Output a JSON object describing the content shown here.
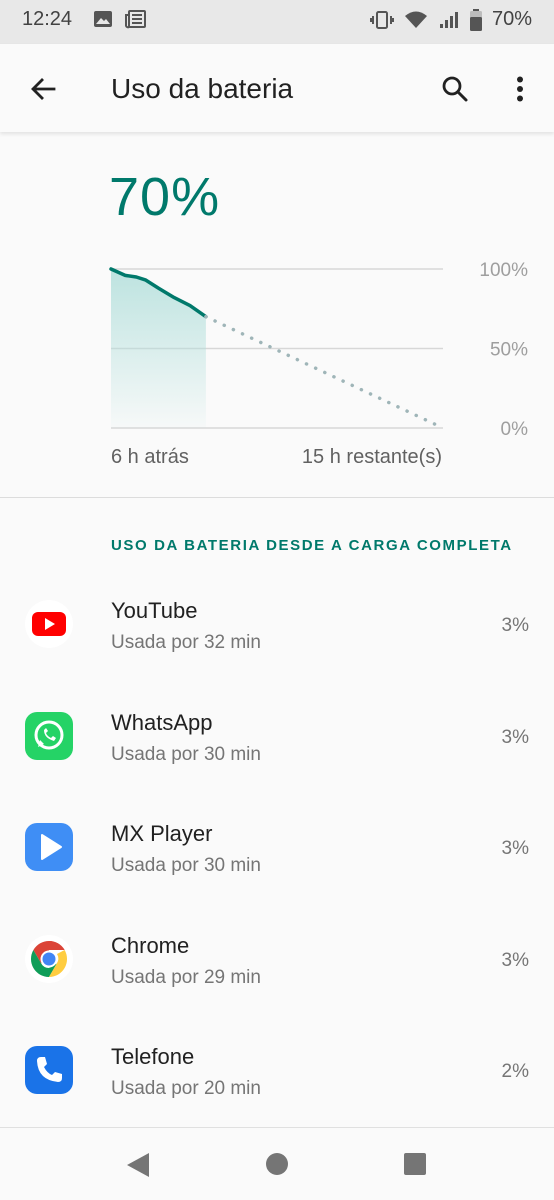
{
  "status_bar": {
    "time": "12:24",
    "battery_percent": "70%",
    "left_icons": [
      "image-icon",
      "news-icon"
    ],
    "right_icons": [
      "vibrate-icon",
      "wifi-icon",
      "signal-icon",
      "battery-icon"
    ]
  },
  "app_bar": {
    "title": "Uso da bateria",
    "back_icon": "arrow-back-icon",
    "search_icon": "search-icon",
    "more_icon": "more-vert-icon"
  },
  "battery": {
    "level": "70%"
  },
  "chart_data": {
    "type": "line",
    "y_tick_labels": [
      "100%",
      "50%",
      "0%"
    ],
    "ylim": [
      0,
      100
    ],
    "x_labels": {
      "start": "6 h atrás",
      "end": "15 h restante(s)"
    },
    "history_series": {
      "x_hours": [
        -6,
        -5.1,
        -4.4,
        -3.8,
        -3.0,
        -2.0,
        -1.0,
        0
      ],
      "y_percent": [
        100,
        96,
        95,
        93,
        88,
        82,
        77,
        70
      ]
    },
    "projection_series": {
      "x_hours": [
        0,
        15
      ],
      "y_percent": [
        70,
        0
      ]
    },
    "colors": {
      "history": "#00796b",
      "fill": "#b2dfdb",
      "projection": "#9fb5b8",
      "grid": "#d7d7d7"
    },
    "grid": true
  },
  "section": {
    "header": "USO DA BATERIA DESDE A CARGA COMPLETA"
  },
  "apps": [
    {
      "name": "YouTube",
      "usage": "Usada por 32 min",
      "percent": "3%",
      "icon": "youtube-icon"
    },
    {
      "name": "WhatsApp",
      "usage": "Usada por 30 min",
      "percent": "3%",
      "icon": "whatsapp-icon"
    },
    {
      "name": "MX Player",
      "usage": "Usada por 30 min",
      "percent": "3%",
      "icon": "mx-player-icon"
    },
    {
      "name": "Chrome",
      "usage": "Usada por 29 min",
      "percent": "3%",
      "icon": "chrome-icon"
    },
    {
      "name": "Telefone",
      "usage": "Usada por 20 min",
      "percent": "2%",
      "icon": "phone-icon"
    }
  ],
  "nav_bar": {
    "icons": [
      "nav-back-icon",
      "nav-home-icon",
      "nav-recents-icon"
    ]
  },
  "colors": {
    "accent": "#00796b",
    "youtube_red": "#ff0000",
    "whatsapp_green": "#25d366",
    "mx_blue": "#3f8ef5",
    "phone_blue": "#1a73e8"
  }
}
